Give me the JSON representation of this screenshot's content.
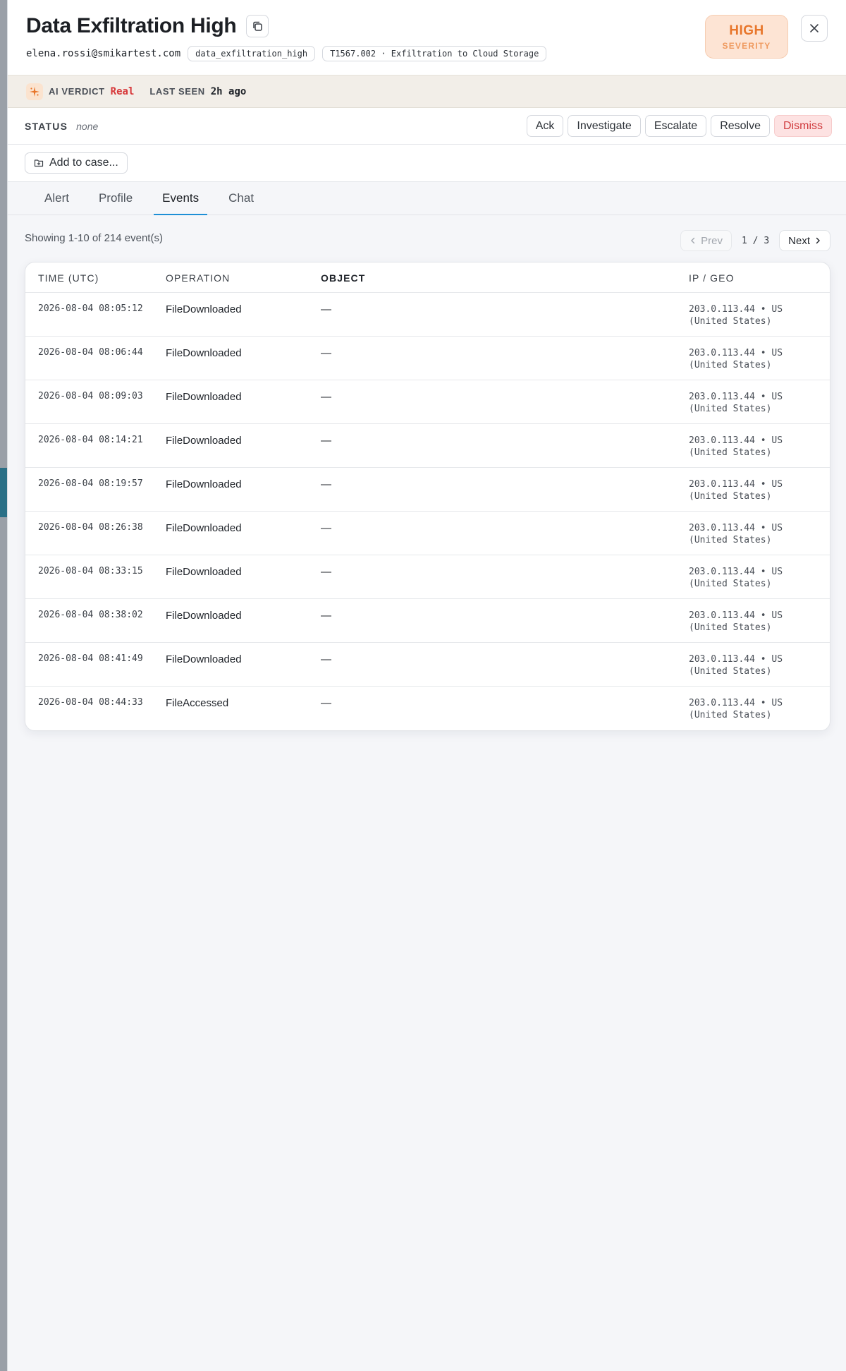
{
  "header": {
    "title": "Data Exfiltration High",
    "email": "elena.rossi@smikartest.com",
    "rule_chip": "data_exfiltration_high",
    "technique_chip": "T1567.002 · Exfiltration to Cloud Storage",
    "severity_level": "HIGH",
    "severity_label": "SEVERITY",
    "severity_color": "#e8762b"
  },
  "verdict": {
    "ai_label": "AI VERDICT",
    "ai_value": "Real",
    "last_seen_label": "LAST SEEN",
    "last_seen_value": "2h ago",
    "verdict_color": "#d7383a"
  },
  "status": {
    "label": "STATUS",
    "value": "none",
    "actions": [
      "Ack",
      "Investigate",
      "Escalate",
      "Resolve",
      "Dismiss"
    ]
  },
  "case": {
    "add_label": "Add to case..."
  },
  "tabs": [
    {
      "label": "Alert",
      "active": false
    },
    {
      "label": "Profile",
      "active": false
    },
    {
      "label": "Events",
      "active": true
    },
    {
      "label": "Chat",
      "active": false
    }
  ],
  "events": {
    "showing": "Showing 1-10 of 214 event(s)",
    "prev_label": "Prev",
    "next_label": "Next",
    "page_indicator": "1 / 3",
    "columns": [
      "TIME (UTC)",
      "OPERATION",
      "OBJECT",
      "IP / GEO"
    ],
    "rows": [
      {
        "time": "2026-08-04 08:05:12",
        "operation": "FileDownloaded",
        "object": "—",
        "ip": "203.0.113.44 • US",
        "geo": "(United States)"
      },
      {
        "time": "2026-08-04 08:06:44",
        "operation": "FileDownloaded",
        "object": "—",
        "ip": "203.0.113.44 • US",
        "geo": "(United States)"
      },
      {
        "time": "2026-08-04 08:09:03",
        "operation": "FileDownloaded",
        "object": "—",
        "ip": "203.0.113.44 • US",
        "geo": "(United States)"
      },
      {
        "time": "2026-08-04 08:14:21",
        "operation": "FileDownloaded",
        "object": "—",
        "ip": "203.0.113.44 • US",
        "geo": "(United States)"
      },
      {
        "time": "2026-08-04 08:19:57",
        "operation": "FileDownloaded",
        "object": "—",
        "ip": "203.0.113.44 • US",
        "geo": "(United States)"
      },
      {
        "time": "2026-08-04 08:26:38",
        "operation": "FileDownloaded",
        "object": "—",
        "ip": "203.0.113.44 • US",
        "geo": "(United States)"
      },
      {
        "time": "2026-08-04 08:33:15",
        "operation": "FileDownloaded",
        "object": "—",
        "ip": "203.0.113.44 • US",
        "geo": "(United States)"
      },
      {
        "time": "2026-08-04 08:38:02",
        "operation": "FileDownloaded",
        "object": "—",
        "ip": "203.0.113.44 • US",
        "geo": "(United States)"
      },
      {
        "time": "2026-08-04 08:41:49",
        "operation": "FileDownloaded",
        "object": "—",
        "ip": "203.0.113.44 • US",
        "geo": "(United States)"
      },
      {
        "time": "2026-08-04 08:44:33",
        "operation": "FileAccessed",
        "object": "—",
        "ip": "203.0.113.44 • US",
        "geo": "(United States)"
      }
    ]
  },
  "icons": {
    "copy": "copy-icon",
    "close": "close-icon",
    "ai": "sparkle-icon",
    "case": "folder-plus-icon",
    "prev": "chevron-left-icon",
    "next": "chevron-right-icon"
  }
}
